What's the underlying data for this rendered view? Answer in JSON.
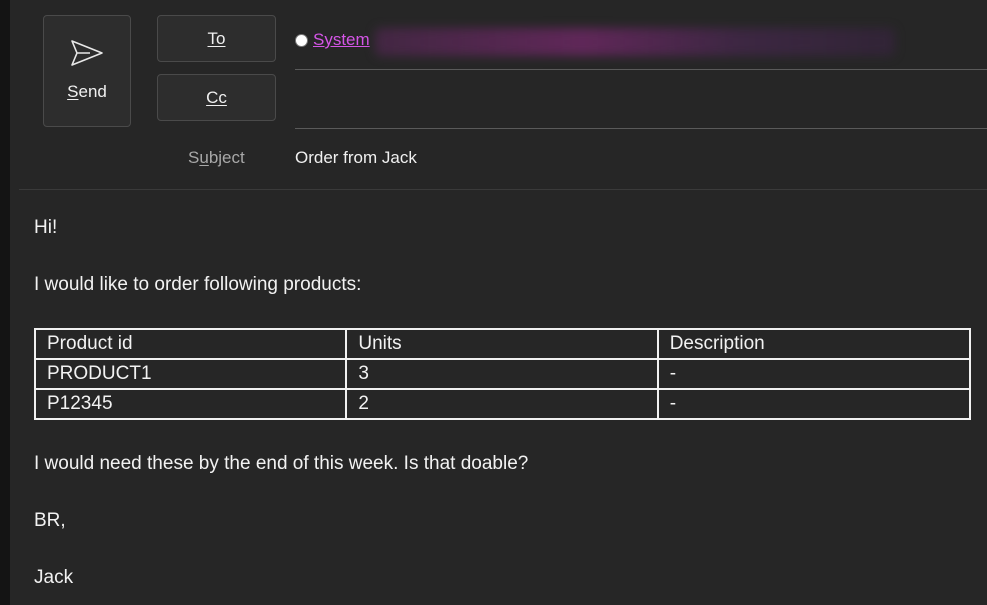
{
  "toolbar": {
    "send_label": "Send",
    "to_label": "To",
    "cc_label": "Cc"
  },
  "recipients": {
    "to": [
      {
        "name": "System"
      }
    ]
  },
  "subject": {
    "label": "Subject",
    "value": "Order from Jack"
  },
  "message": {
    "greeting": "Hi!",
    "intro": "I would like to order following products:",
    "table": {
      "headers": [
        "Product id",
        "Units",
        "Description"
      ],
      "rows": [
        [
          "PRODUCT1",
          "3",
          "-"
        ],
        [
          "P12345",
          "2",
          "-"
        ]
      ]
    },
    "closing": "I would need these by the end of this week. Is that doable?",
    "signoff": "BR,",
    "signature": "Jack"
  },
  "colors": {
    "background": "#262626",
    "recipient_link": "#d455e6",
    "text": "#f2f2f2"
  }
}
